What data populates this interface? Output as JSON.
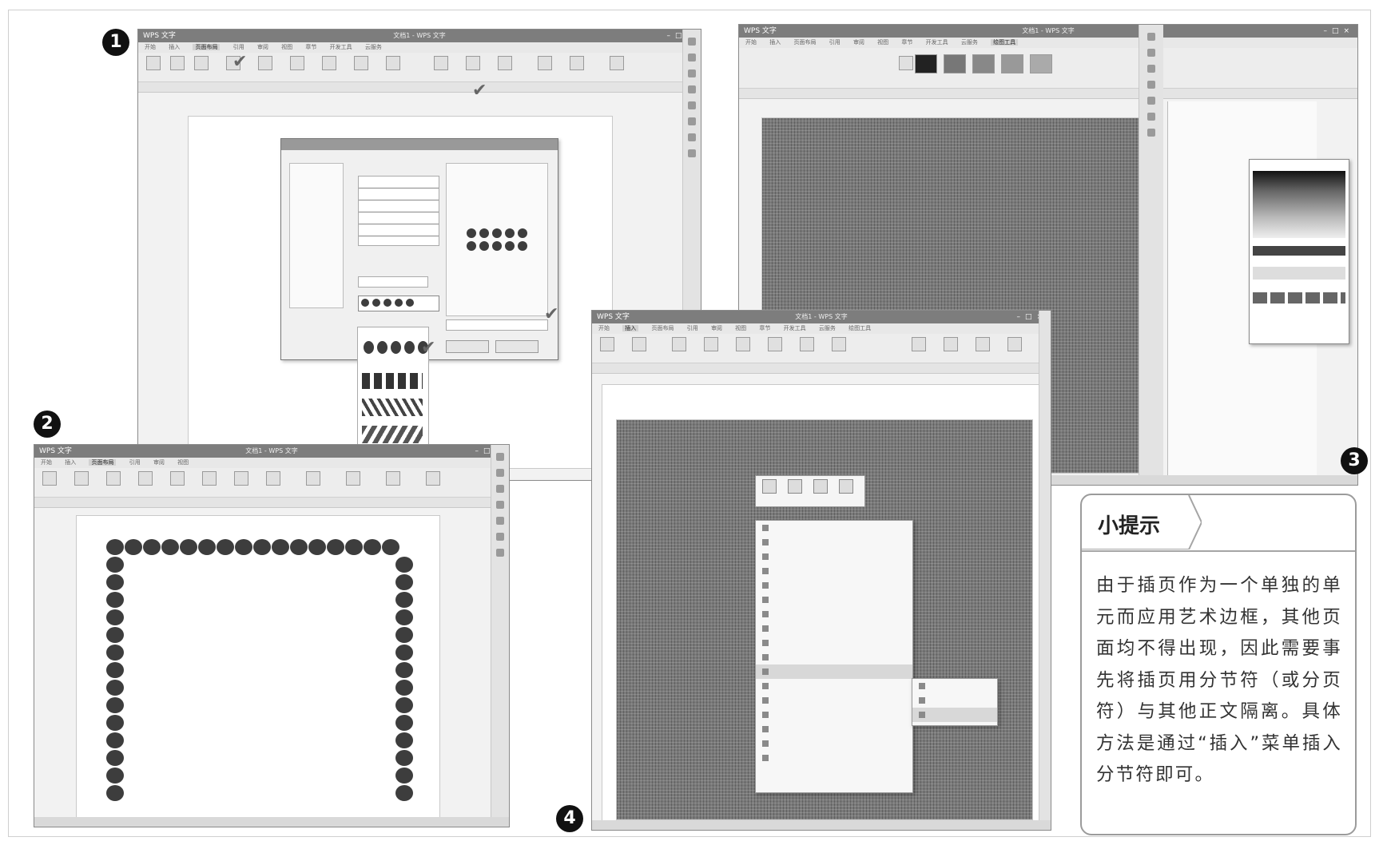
{
  "badges": {
    "b1": "1",
    "b2": "2",
    "b3": "3",
    "b4": "4"
  },
  "app": {
    "name": "WPS 文字",
    "doc_title": "文档1 - WPS 文字"
  },
  "ribbon_tabs": [
    "开始",
    "插入",
    "页面布局",
    "引用",
    "审阅",
    "视图",
    "章节",
    "开发工具",
    "云服务",
    "绘图工具"
  ],
  "tip": {
    "heading": "小提示",
    "text": "由于插页作为一个单独的单元而应用艺术边框，其他页面均不得出现，因此需要事先将插页用分节符（或分页符）与其他正文隔离。具体方法是通过“插入”菜单插入分节符即可。"
  },
  "icons": [
    "wps-logo-icon",
    "minimize-icon",
    "maximize-icon",
    "close-icon",
    "checkmark-icon",
    "dot-border-icon",
    "sidebar-tool-icon"
  ],
  "colors": {
    "pattern": "#7a7a7a",
    "dot": "#3d3d3d",
    "tip_border": "#9b9b9b",
    "badge": "#111111"
  }
}
